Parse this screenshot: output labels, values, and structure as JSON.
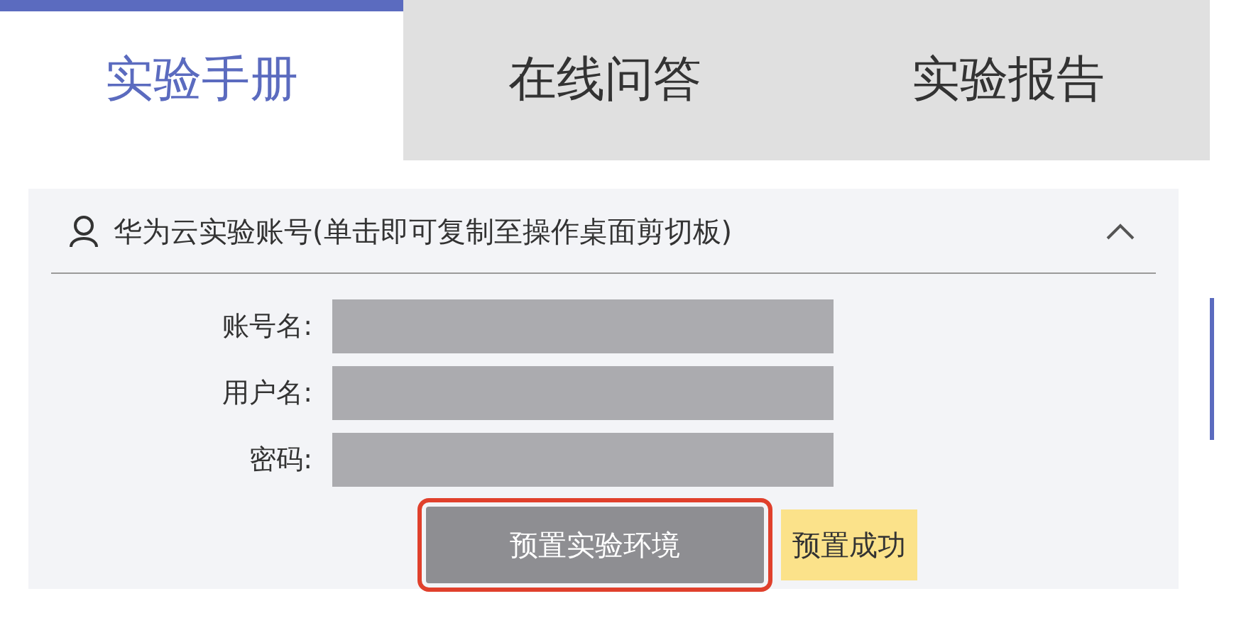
{
  "tabs": [
    {
      "label": "实验手册",
      "selected": true
    },
    {
      "label": "在线问答",
      "selected": false
    },
    {
      "label": "实验报告",
      "selected": false
    }
  ],
  "account_panel": {
    "title": "华为云实验账号(单击即可复制至操作桌面剪切板)",
    "expanded": true,
    "fields": [
      {
        "label": "账号名:"
      },
      {
        "label": "用户名:"
      },
      {
        "label": "密码:"
      }
    ],
    "button": {
      "label": "预置实验环境",
      "highlighted": true
    },
    "status": "预置成功"
  }
}
